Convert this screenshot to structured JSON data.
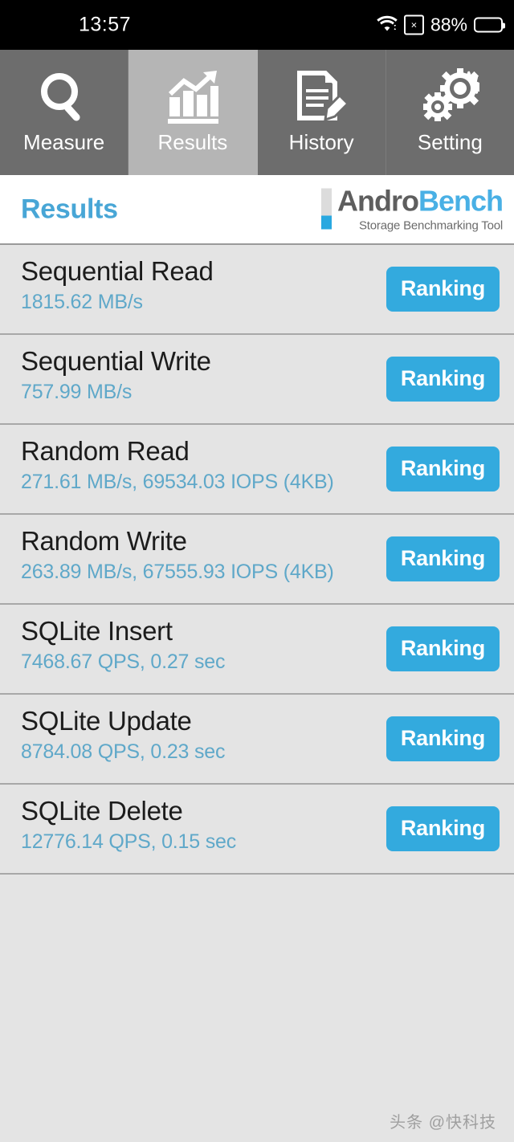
{
  "status_bar": {
    "time": "13:57",
    "wifi_icon": "wifi-icon",
    "nosim_icon": "no-sim-icon",
    "nosim_glyph": "×",
    "battery_percent": "88%",
    "battery_icon": "battery-icon"
  },
  "tabs": [
    {
      "label": "Measure",
      "icon": "magnifier-icon",
      "active": false
    },
    {
      "label": "Results",
      "icon": "bar-chart-icon",
      "active": true
    },
    {
      "label": "History",
      "icon": "document-pencil-icon",
      "active": false
    },
    {
      "label": "Setting",
      "icon": "gears-icon",
      "active": false
    }
  ],
  "header": {
    "title": "Results",
    "logo_andro": "Andro",
    "logo_bench": "Bench",
    "logo_tagline": "Storage Benchmarking Tool"
  },
  "results": [
    {
      "name": "Sequential Read",
      "value": "1815.62 MB/s",
      "button": "Ranking"
    },
    {
      "name": "Sequential Write",
      "value": "757.99 MB/s",
      "button": "Ranking"
    },
    {
      "name": "Random Read",
      "value": "271.61 MB/s, 69534.03 IOPS (4KB)",
      "button": "Ranking"
    },
    {
      "name": "Random Write",
      "value": "263.89 MB/s, 67555.93 IOPS (4KB)",
      "button": "Ranking"
    },
    {
      "name": "SQLite Insert",
      "value": "7468.67 QPS, 0.27 sec",
      "button": "Ranking"
    },
    {
      "name": "SQLite Update",
      "value": "8784.08 QPS, 0.23 sec",
      "button": "Ranking"
    },
    {
      "name": "SQLite Delete",
      "value": "12776.14 QPS, 0.15 sec",
      "button": "Ranking"
    }
  ],
  "watermark": "头条 @快科技",
  "colors": {
    "accent_blue": "#33aade",
    "title_blue": "#48a6d6",
    "value_blue": "#5fa8c9",
    "tab_inactive": "#6d6d6d",
    "tab_active": "#b5b5b5",
    "list_bg": "#e4e4e4",
    "status_bg": "#000000"
  }
}
